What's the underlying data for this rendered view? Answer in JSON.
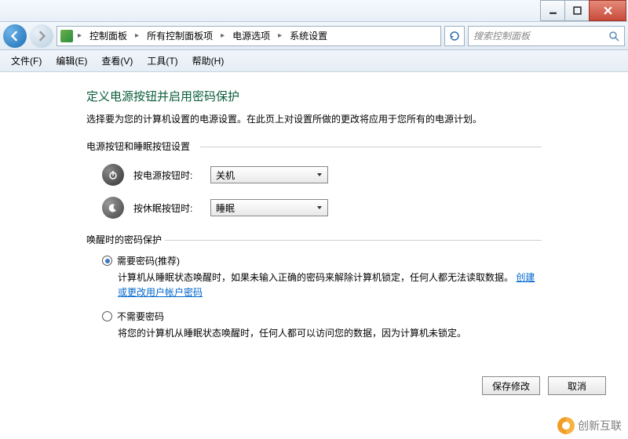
{
  "titlebar": {
    "min": "minimize",
    "max": "maximize",
    "close": "close"
  },
  "nav": {
    "breadcrumb": [
      "控制面板",
      "所有控制面板项",
      "电源选项",
      "系统设置"
    ],
    "search_placeholder": "搜索控制面板"
  },
  "menu": {
    "file": "文件(F)",
    "edit": "编辑(E)",
    "view": "查看(V)",
    "tools": "工具(T)",
    "help": "帮助(H)"
  },
  "page": {
    "title": "定义电源按钮并启用密码保护",
    "description": "选择要为您的计算机设置的电源设置。在此页上对设置所做的更改将应用于您所有的电源计划。",
    "group1_label": "电源按钮和睡眠按钮设置",
    "power_button_label": "按电源按钮时:",
    "power_button_value": "关机",
    "sleep_button_label": "按休眠按钮时:",
    "sleep_button_value": "睡眠",
    "group2_label": "唤醒时的密码保护",
    "radio1_label": "需要密码(推荐)",
    "radio1_desc_a": "计算机从睡眠状态唤醒时，如果未输入正确的密码来解除计算机锁定，任何人都无法读取数据。",
    "radio1_link": "创建或更改用户帐户密码",
    "radio2_label": "不需要密码",
    "radio2_desc": "将您的计算机从睡眠状态唤醒时，任何人都可以访问您的数据，因为计算机未锁定。"
  },
  "footer": {
    "save": "保存修改",
    "cancel": "取消"
  },
  "watermark": "创新互联",
  "colors": {
    "heading": "#0b5d3b",
    "link": "#0066cc"
  }
}
